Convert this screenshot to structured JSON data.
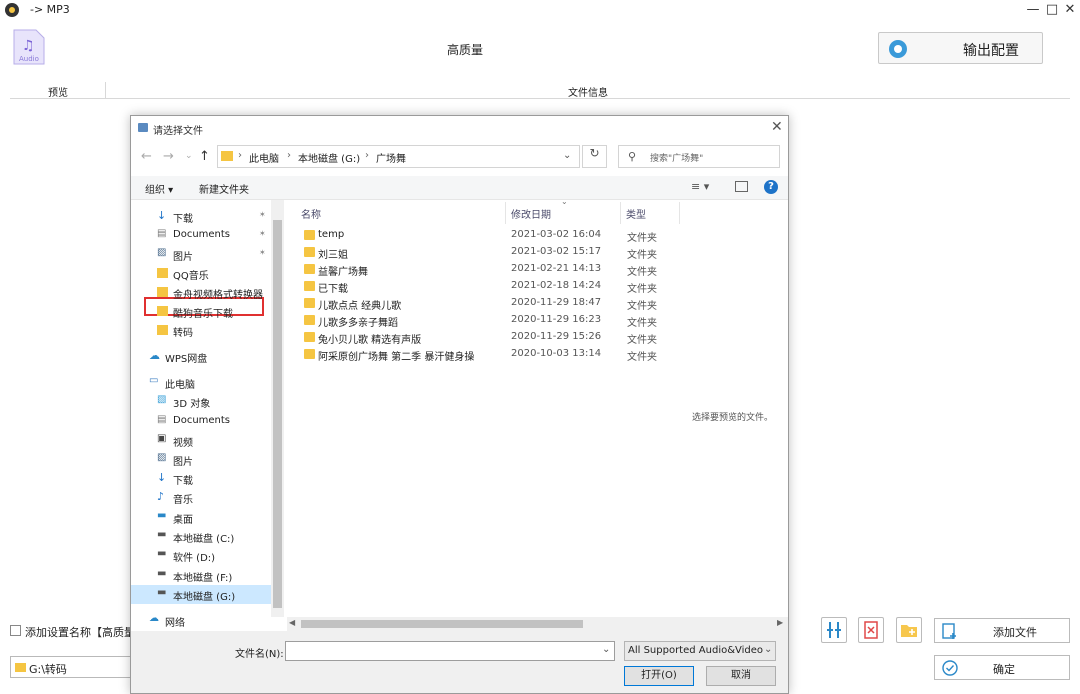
{
  "app": {
    "title": "-> MP3",
    "audio_label": "Audio",
    "quality": "高质量",
    "output_config": "输出配置",
    "columns": {
      "preview": "预览",
      "file_info": "文件信息"
    },
    "add_setting_name": "添加设置名称【高质量】",
    "output_path": "G:\\转码",
    "add_file": "添加文件",
    "confirm": "确定"
  },
  "dialog": {
    "title": "请选择文件",
    "breadcrumb": [
      "此电脑",
      "本地磁盘 (G:)",
      "广场舞"
    ],
    "search_placeholder": "搜索\"广场舞\"",
    "toolbar": {
      "organize": "组织 ▾",
      "new_folder": "新建文件夹"
    },
    "nav_items": [
      {
        "label": "下载",
        "icon": "download-icon"
      },
      {
        "label": "Documents",
        "icon": "document-icon"
      },
      {
        "label": "图片",
        "icon": "picture-icon"
      },
      {
        "label": "QQ音乐",
        "icon": "folder-icon"
      },
      {
        "label": "金舟视频格式转换器",
        "icon": "folder-icon"
      },
      {
        "label": "酷狗音乐下载",
        "icon": "folder-icon"
      },
      {
        "label": "转码",
        "icon": "folder-icon"
      },
      {
        "label": "WPS网盘",
        "icon": "cloud-icon"
      },
      {
        "label": "此电脑",
        "icon": "computer-icon"
      },
      {
        "label": "3D 对象",
        "icon": "cube-icon"
      },
      {
        "label": "Documents",
        "icon": "document-icon"
      },
      {
        "label": "视频",
        "icon": "video-icon"
      },
      {
        "label": "图片",
        "icon": "picture-icon"
      },
      {
        "label": "下载",
        "icon": "download-icon"
      },
      {
        "label": "音乐",
        "icon": "music-icon"
      },
      {
        "label": "桌面",
        "icon": "desktop-icon"
      },
      {
        "label": "本地磁盘 (C:)",
        "icon": "drive-icon"
      },
      {
        "label": "软件 (D:)",
        "icon": "drive-icon"
      },
      {
        "label": "本地磁盘 (F:)",
        "icon": "drive-icon"
      },
      {
        "label": "本地磁盘 (G:)",
        "icon": "drive-icon"
      },
      {
        "label": "网络",
        "icon": "network-icon"
      }
    ],
    "file_columns": {
      "name": "名称",
      "date": "修改日期",
      "type": "类型"
    },
    "files": [
      {
        "name": "temp",
        "date": "2021-03-02 16:04",
        "type": "文件夹"
      },
      {
        "name": "刘三姐",
        "date": "2021-03-02 15:17",
        "type": "文件夹"
      },
      {
        "name": "益馨广场舞",
        "date": "2021-02-21 14:13",
        "type": "文件夹"
      },
      {
        "name": "已下载",
        "date": "2021-02-18 14:24",
        "type": "文件夹"
      },
      {
        "name": "儿歌点点 经典儿歌",
        "date": "2020-11-29 18:47",
        "type": "文件夹"
      },
      {
        "name": "儿歌多多亲子舞蹈",
        "date": "2020-11-29 16:23",
        "type": "文件夹"
      },
      {
        "name": "兔小贝儿歌 精选有声版",
        "date": "2020-11-29 15:26",
        "type": "文件夹"
      },
      {
        "name": "阿采原创广场舞 第二季 暴汗健身操",
        "date": "2020-10-03 13:14",
        "type": "文件夹"
      }
    ],
    "preview_hint": "选择要预览的文件。",
    "filename_label": "文件名(N):",
    "filename_value": "",
    "filter": "All Supported Audio&Video",
    "open": "打开(O)",
    "cancel": "取消"
  },
  "colors": {
    "folder": "#f5c542",
    "selection": "#cce8ff",
    "highlight": "#e03030",
    "accent": "#1e73c8"
  }
}
